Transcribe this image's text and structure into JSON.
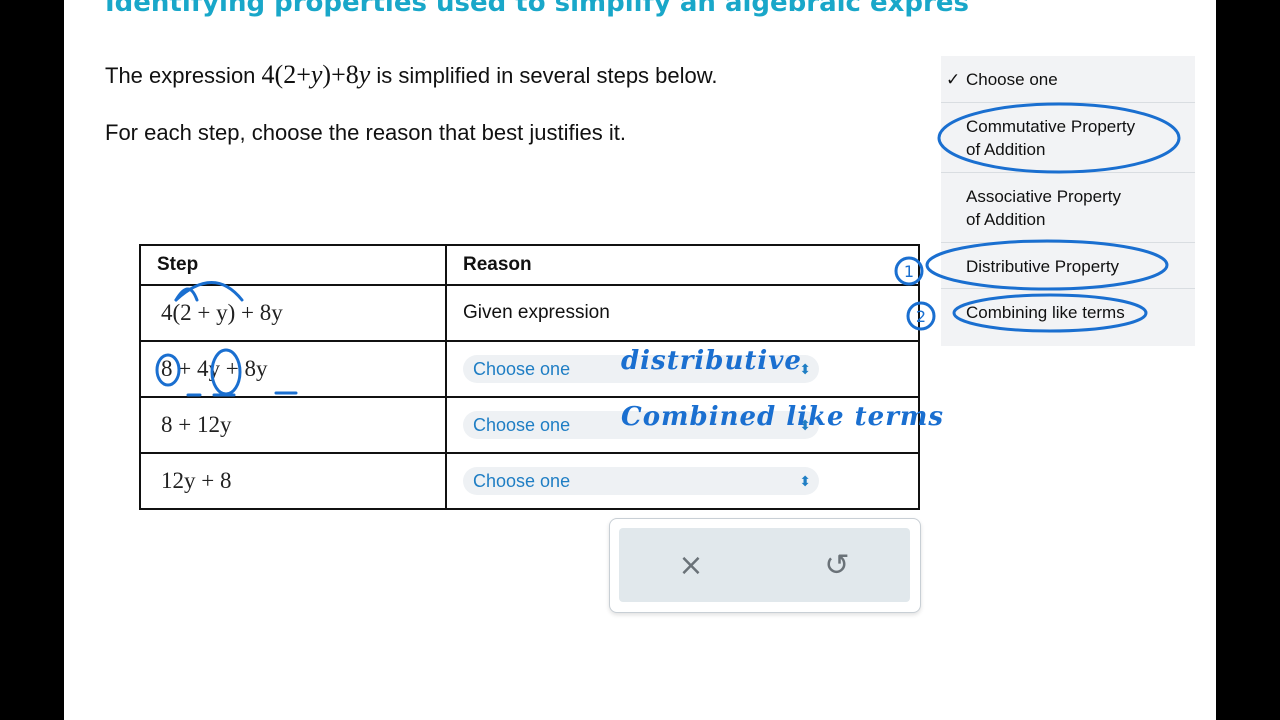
{
  "title": "Identifying properties used to simplify an algebraic expres",
  "intro": {
    "prefix": "The expression ",
    "expr_a": "4",
    "expr_b": "(2+",
    "expr_var": "y",
    "expr_c": ")+8",
    "expr_var2": "y",
    "suffix": " is simplified in several steps below."
  },
  "instruction": "For each step, choose the reason that best justifies it.",
  "table": {
    "col_step": "Step",
    "col_reason": "Reason",
    "rows": [
      {
        "step": "4(2 + y) + 8y",
        "reason": "Given expression"
      },
      {
        "step": "8 + 4y + 8y",
        "reason": "Choose one",
        "handwritten": "distributive"
      },
      {
        "step": "8 + 12y",
        "reason": "Choose one",
        "handwritten": "Combined like terms"
      },
      {
        "step": "12y + 8",
        "reason": "Choose one"
      }
    ]
  },
  "toolbar": {
    "clear_icon": "×",
    "undo_icon": "↺"
  },
  "dropdown": {
    "check": "✓",
    "options": [
      "Choose one",
      "Commutative Property",
      "of Addition",
      "Associative Property",
      "of Addition",
      "Distributive Property",
      "Combining like terms"
    ]
  },
  "annotations": {
    "mark_1": "1",
    "mark_2": "2"
  },
  "colors": {
    "title": "#19a7c9",
    "select_text": "#1f7ec4",
    "ink": "#1a6fd0"
  }
}
